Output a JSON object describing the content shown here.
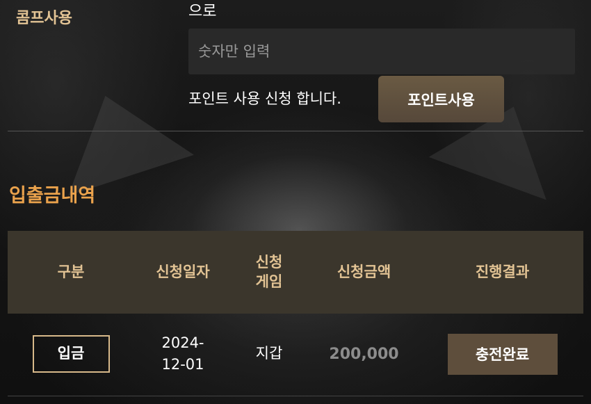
{
  "comp": {
    "section_label": "콤프사용",
    "top_text": "으로",
    "input_placeholder": "숫자만 입력",
    "apply_text": "포인트 사용 신청 합니다.",
    "use_button": "포인트사용"
  },
  "history": {
    "title": "입출금내역",
    "columns": [
      "구분",
      "신청일자",
      "신청\n게임",
      "신청금액",
      "진행결과"
    ],
    "rows": [
      {
        "type": "입금",
        "date": "2024-\n12-01",
        "game": "지갑",
        "amount": "200,000",
        "status": "충전완료"
      }
    ]
  },
  "colors": {
    "gold_label": "#e2c394",
    "orange_title": "#eaa24c",
    "header_bg": "#3b362c",
    "button_bg": "#5e4e3c"
  }
}
